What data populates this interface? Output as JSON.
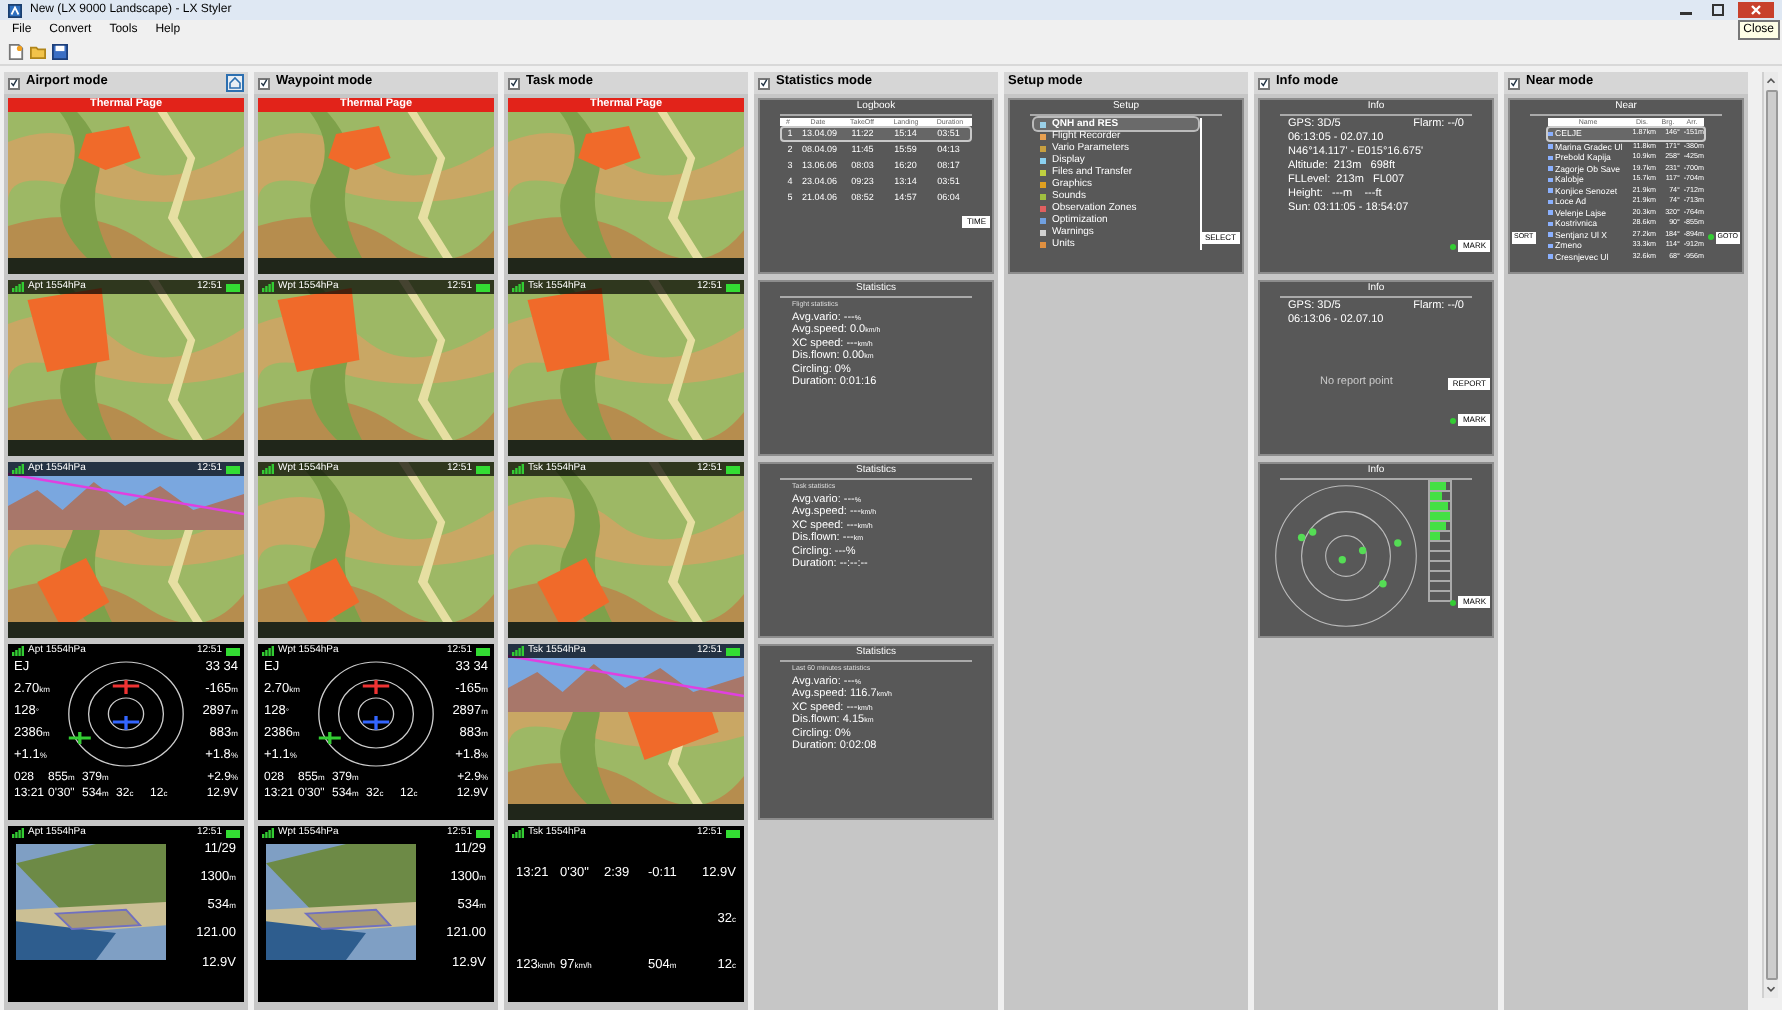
{
  "window": {
    "title": "New (LX 9000 Landscape) - LX Styler",
    "tooltip": "Close"
  },
  "menu": [
    "File",
    "Convert",
    "Tools",
    "Help"
  ],
  "columns": [
    {
      "title": "Airport mode",
      "checked": true,
      "home_button": true,
      "screens": [
        {
          "kind": "map",
          "banner": "Thermal Page",
          "profile": false
        },
        {
          "kind": "map",
          "header": "Apt 1554hPa",
          "time": "12:51",
          "profile": false
        },
        {
          "kind": "map",
          "header": "Apt 1554hPa",
          "time": "12:51",
          "profile": true
        },
        {
          "kind": "radar",
          "header": "Apt 1554hPa",
          "time": "12:51",
          "left": [
            {
              "v": "EJ"
            },
            {
              "v": "2.70",
              "u": "km"
            },
            {
              "v": "128",
              "u": "°"
            },
            {
              "v": "2386",
              "u": "m"
            },
            {
              "v": "+1.1",
              "u": "%"
            }
          ],
          "right": [
            {
              "v": "33 34"
            },
            {
              "v": "-165",
              "u": "m"
            },
            {
              "v": "2897",
              "u": "m"
            },
            {
              "v": "883",
              "u": "m"
            },
            {
              "v": "+1.8",
              "u": "%"
            }
          ],
          "rows": [
            [
              {
                "v": "028"
              },
              {
                "v": "855",
                "u": "m"
              },
              {
                "v": "379",
                "u": "m"
              },
              {},
              {},
              {
                "v": "+2.9",
                "u": "%"
              }
            ],
            [
              {
                "v": "13:21"
              },
              {
                "v": "0'30\""
              },
              {
                "v": "534",
                "u": "m"
              },
              {
                "v": "32",
                "u": "c"
              },
              {
                "v": "12",
                "u": "c"
              },
              {
                "v": "12.9V"
              }
            ]
          ]
        },
        {
          "header": "Apt 1554hPa",
          "time": "12:51",
          "values": [
            {
              "v": "11/29"
            },
            {
              "v": "1300",
              "u": "m"
            },
            {
              "v": "534",
              "u": "m"
            },
            {
              "v": "121.00"
            },
            {
              "v": "12.9V"
            }
          ]
        }
      ]
    },
    {
      "title": "Waypoint mode",
      "checked": true,
      "home_button": false,
      "screens": [
        {
          "kind": "map",
          "banner": "Thermal Page",
          "profile": false
        },
        {
          "kind": "map",
          "header": "Wpt 1554hPa",
          "time": "12:51",
          "profile": false
        },
        {
          "kind": "map",
          "header": "Wpt 1554hPa",
          "time": "12:51",
          "profile": false
        },
        {
          "kind": "radar",
          "header": "Wpt 1554hPa",
          "time": "12:51",
          "left": [
            {
              "v": "EJ"
            },
            {
              "v": "2.70",
              "u": "km"
            },
            {
              "v": "128",
              "u": "°"
            },
            {
              "v": "2386",
              "u": "m"
            },
            {
              "v": "+1.1",
              "u": "%"
            }
          ],
          "right": [
            {
              "v": "33 34"
            },
            {
              "v": "-165",
              "u": "m"
            },
            {
              "v": "2897",
              "u": "m"
            },
            {
              "v": "883",
              "u": "m"
            },
            {
              "v": "+1.8",
              "u": "%"
            }
          ],
          "rows": [
            [
              {
                "v": "028"
              },
              {
                "v": "855",
                "u": "m"
              },
              {
                "v": "379",
                "u": "m"
              },
              {},
              {},
              {
                "v": "+2.9",
                "u": "%"
              }
            ],
            [
              {
                "v": "13:21"
              },
              {
                "v": "0'30\""
              },
              {
                "v": "534",
                "u": "m"
              },
              {
                "v": "32",
                "u": "c"
              },
              {
                "v": "12",
                "u": "c"
              },
              {
                "v": "12.9V"
              }
            ]
          ]
        },
        {
          "header": "Wpt 1554hPa",
          "time": "12:51",
          "values": [
            {
              "v": "11/29"
            },
            {
              "v": "1300",
              "u": "m"
            },
            {
              "v": "534",
              "u": "m"
            },
            {
              "v": "121.00"
            },
            {
              "v": "12.9V"
            }
          ]
        }
      ]
    },
    {
      "title": "Task mode",
      "checked": true,
      "home_button": false,
      "screens": [
        {
          "kind": "map",
          "banner": "Thermal Page",
          "profile": false
        },
        {
          "kind": "map",
          "header": "Tsk 1554hPa",
          "time": "12:51",
          "profile": false
        },
        {
          "kind": "map",
          "header": "Tsk 1554hPa",
          "time": "12:51",
          "profile": false
        },
        {
          "kind": "map",
          "header": "Tsk 1554hPa",
          "time": "12:51",
          "profile": true
        },
        {
          "kind": "numbers",
          "header": "Tsk 1554hPa",
          "time": "12:51",
          "rows": [
            [
              {
                "v": "13:21"
              },
              {
                "v": "0'30\""
              },
              {
                "v": "2:39"
              },
              {
                "v": "-0:11"
              },
              {
                "v": "12.9V"
              }
            ],
            [
              {},
              {},
              {},
              {},
              {
                "v": "32",
                "u": "c"
              }
            ],
            [
              {
                "v": "123",
                "u": "km/h"
              },
              {
                "v": "97",
                "u": "km/h"
              },
              {},
              {
                "v": "504",
                "u": "m"
              },
              {
                "v": "12",
                "u": "c"
              }
            ]
          ]
        }
      ]
    },
    {
      "title": "Statistics mode",
      "checked": true,
      "home_button": false,
      "panels": [
        {
          "kind": "logbook",
          "title": "Logbook",
          "columns": [
            "#",
            "Date",
            "TakeOff",
            "Landing",
            "Duration"
          ],
          "button": "TIME",
          "rows": [
            {
              "cells": [
                "1",
                "13.04.09",
                "11:22",
                "15:14",
                "03:51"
              ],
              "selected": true
            },
            {
              "cells": [
                "2",
                "08.04.09",
                "11:45",
                "15:59",
                "04:13"
              ],
              "selected": false
            },
            {
              "cells": [
                "3",
                "13.06.06",
                "08:03",
                "16:20",
                "08:17"
              ],
              "selected": false
            },
            {
              "cells": [
                "4",
                "23.04.06",
                "09:23",
                "13:14",
                "03:51"
              ],
              "selected": false
            },
            {
              "cells": [
                "5",
                "21.04.06",
                "08:52",
                "14:57",
                "06:04"
              ],
              "selected": false
            }
          ]
        },
        {
          "kind": "stats",
          "title": "Statistics",
          "subtitle": "Flight statistics",
          "lines": [
            {
              "label": "Avg.vario:",
              "v": "---",
              "u": "%"
            },
            {
              "label": "Avg.speed:",
              "v": "0.0",
              "u": "km/h"
            },
            {
              "label": "XC speed:",
              "v": "---",
              "u": "km/h"
            },
            {
              "label": "Dis.flown:",
              "v": "0.00",
              "u": "km"
            },
            {
              "label": "Circling:",
              "v": "0%"
            },
            {
              "label": "Duration:",
              "v": "0:01:16"
            }
          ]
        },
        {
          "kind": "stats",
          "title": "Statistics",
          "subtitle": "Task statistics",
          "lines": [
            {
              "label": "Avg.vario:",
              "v": "---",
              "u": "%"
            },
            {
              "label": "Avg.speed:",
              "v": "---",
              "u": "km/h"
            },
            {
              "label": "XC speed:",
              "v": "---",
              "u": "km/h"
            },
            {
              "label": "Dis.flown:",
              "v": "---",
              "u": "km"
            },
            {
              "label": "Circling:",
              "v": "---%"
            },
            {
              "label": "Duration:",
              "v": "--:--:--"
            }
          ]
        },
        {
          "kind": "stats",
          "title": "Statistics",
          "subtitle": "Last 60 minutes statistics",
          "lines": [
            {
              "label": "Avg.vario:",
              "v": "---",
              "u": "%"
            },
            {
              "label": "Avg.speed:",
              "v": "116.7",
              "u": "km/h"
            },
            {
              "label": "XC speed:",
              "v": "---",
              "u": "km/h"
            },
            {
              "label": "Dis.flown:",
              "v": "4.15",
              "u": "km"
            },
            {
              "label": "Circling:",
              "v": "0%"
            },
            {
              "label": "Duration:",
              "v": "0:02:08"
            }
          ]
        }
      ]
    },
    {
      "title": "Setup mode",
      "panels": [
        {
          "kind": "setup",
          "title": "Setup",
          "button": "SELECT",
          "items": [
            {
              "label": "QNH and RES",
              "color": "#9ad0e8",
              "selected": true
            },
            {
              "label": "Flight Recorder",
              "color": "#e8a050",
              "selected": false
            },
            {
              "label": "Vario Parameters",
              "color": "#c8a040",
              "selected": false
            },
            {
              "label": "Display",
              "color": "#8ad0f0",
              "selected": false
            },
            {
              "label": "Files and Transfer",
              "color": "#c0d040",
              "selected": false
            },
            {
              "label": "Graphics",
              "color": "#e0a020",
              "selected": false
            },
            {
              "label": "Sounds",
              "color": "#a0c040",
              "selected": false
            },
            {
              "label": "Observation Zones",
              "color": "#e06060",
              "selected": false
            },
            {
              "label": "Optimization",
              "color": "#70a0e0",
              "selected": false
            },
            {
              "label": "Warnings",
              "color": "#d0d0d0",
              "selected": false
            },
            {
              "label": "Units",
              "color": "#e09040",
              "selected": false
            }
          ]
        }
      ]
    },
    {
      "title": "Info mode",
      "checked": true,
      "home_button": false,
      "panels": [
        {
          "kind": "info",
          "title": "Info",
          "button": "MARK",
          "lines": [
            [
              "GPS: 3D/5",
              "Flarm: --/0"
            ],
            [
              "06:13:05 - 02.07.10"
            ],
            [
              "N46°14.117' - E015°16.675'"
            ],
            [
              "Altitude:  213m   698ft"
            ],
            [
              "FLLevel:  213m   FL007"
            ],
            [
              "Height:   ---m    ---ft"
            ],
            [
              "Sun: 03:11:05 - 18:54:07"
            ]
          ]
        },
        {
          "kind": "report",
          "title": "Info",
          "buttons": [
            "REPORT",
            "MARK"
          ],
          "lines": [
            [
              "GPS: 3D/5",
              "Flarm: --/0"
            ],
            [
              "06:13:06 - 02.07.10"
            ]
          ],
          "message": "No report point"
        },
        {
          "kind": "thermal",
          "title": "Info",
          "button": "MARK",
          "bars": [
            {
              "level": 0.8
            },
            {
              "level": 0.6
            },
            {
              "level": 0.85
            },
            {
              "level": 0.95
            },
            {
              "level": 0.75
            },
            {
              "level": 0.5
            },
            {
              "level": 0
            },
            {
              "level": 0
            },
            {
              "level": 0
            },
            {
              "level": 0
            },
            {
              "level": 0
            },
            {
              "level": 0
            }
          ]
        }
      ]
    },
    {
      "title": "Near mode",
      "checked": true,
      "home_button": false,
      "panels": [
        {
          "kind": "near",
          "title": "Near",
          "columns": [
            "Name",
            "Dis.",
            "Brg.",
            "Arr."
          ],
          "buttons": [
            "SORT",
            "GOTO"
          ],
          "rows": [
            {
              "cells": [
                "CELJE",
                "1.87km",
                "146°",
                "-151m"
              ],
              "selected": true
            },
            {
              "cells": [
                "Marina Gradec Ul",
                "11.8km",
                "171°",
                "-380m"
              ],
              "selected": false
            },
            {
              "cells": [
                "Prebold Kapija",
                "10.9km",
                "258°",
                "-425m"
              ],
              "selected": false
            },
            {
              "cells": [
                "Zagorje Ob Save",
                "19.7km",
                "231°",
                "-700m"
              ],
              "selected": false
            },
            {
              "cells": [
                "Kalobje",
                "15.7km",
                "117°",
                "-704m"
              ],
              "selected": false
            },
            {
              "cells": [
                "Konjice Senozet",
                "21.9km",
                "74°",
                "-712m"
              ],
              "selected": false
            },
            {
              "cells": [
                "Loce Ad",
                "21.9km",
                "74°",
                "-713m"
              ],
              "selected": false
            },
            {
              "cells": [
                "Velenje Lajse",
                "20.3km",
                "320°",
                "-764m"
              ],
              "selected": false
            },
            {
              "cells": [
                "Kostrivnica",
                "28.6km",
                "90°",
                "-855m"
              ],
              "selected": false
            },
            {
              "cells": [
                "Sentjanz Ul X",
                "27.2km",
                "184°",
                "-894m"
              ],
              "selected": false
            },
            {
              "cells": [
                "Zmeno",
                "33.3km",
                "114°",
                "-912m"
              ],
              "selected": false
            },
            {
              "cells": [
                "Cresnjevec Ul",
                "32.6km",
                "68°",
                "-956m"
              ],
              "selected": false
            }
          ]
        }
      ]
    }
  ]
}
